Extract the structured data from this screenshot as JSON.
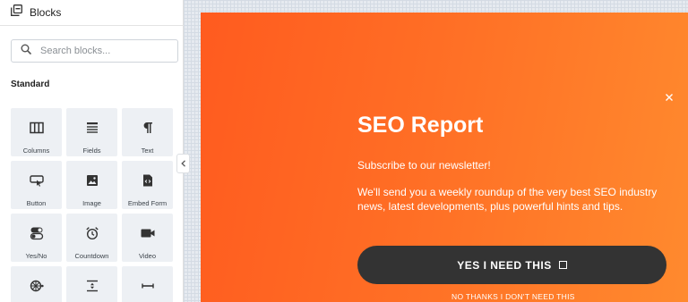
{
  "sidebar": {
    "title": "Blocks",
    "search_placeholder": "Search blocks...",
    "section_title": "Standard",
    "blocks": [
      {
        "label": "Columns",
        "icon": "columns-icon"
      },
      {
        "label": "Fields",
        "icon": "fields-icon"
      },
      {
        "label": "Text",
        "icon": "paragraph-icon"
      },
      {
        "label": "Button",
        "icon": "button-icon"
      },
      {
        "label": "Image",
        "icon": "image-icon"
      },
      {
        "label": "Embed Form",
        "icon": "embed-form-icon"
      },
      {
        "label": "Yes/No",
        "icon": "yes-no-icon"
      },
      {
        "label": "Countdown",
        "icon": "alarm-clock-icon"
      },
      {
        "label": "Video",
        "icon": "video-camera-icon"
      },
      {
        "label": "",
        "icon": "spinner-icon"
      },
      {
        "label": "",
        "icon": "spacer-icon"
      },
      {
        "label": "",
        "icon": "divider-icon"
      }
    ]
  },
  "popup": {
    "title": "SEO Report",
    "subtitle": "Subscribe to our newsletter!",
    "body": "We'll send you a weekly roundup of the very best SEO industry news, latest developments, plus powerful hints and tips.",
    "cta_label": "YES I NEED THIS",
    "decline_label": "NO THANKS I DON'T NEED THIS",
    "colors": {
      "gradient_start": "#ff5b1f",
      "gradient_end": "#ff8a2e",
      "button": "#333333"
    }
  }
}
